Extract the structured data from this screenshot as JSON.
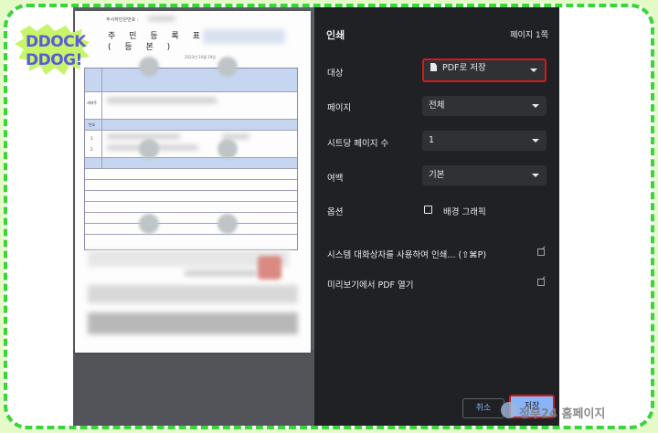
{
  "brand": {
    "logo_line1": "DDOCK",
    "logo_line2": "DDOG!",
    "watermark": "정부24 홈페이지",
    "colors": {
      "frame": "#3bd43b",
      "outer_bg": "#e4fbc8",
      "highlight": "#d31a1a",
      "accent": "#8ab4f8"
    }
  },
  "document": {
    "header": "주사하민원번호 :",
    "title_line1": "주 민 등 록 표",
    "title_line2": "( 등     본 )",
    "date": "2023년 10월 19일",
    "row_labels": [
      "세대주",
      "번호",
      "1",
      "2"
    ]
  },
  "dialog": {
    "title": "인쇄",
    "page_count": "페이지 1쪽",
    "destination_label": "대상",
    "destination_value": "PDF로 저장",
    "pages_label": "페이지",
    "pages_value": "전체",
    "pages_per_sheet_label": "시트당 페이지 수",
    "pages_per_sheet_value": "1",
    "margins_label": "여백",
    "margins_value": "기본",
    "options_label": "옵션",
    "background_graphics_label": "배경 그래픽",
    "system_dialog_link": "시스템 대화상자를 사용하여 인쇄... (⇧⌘P)",
    "open_pdf_link": "미리보기에서 PDF 열기",
    "cancel_label": "취소",
    "save_label": "저장"
  }
}
